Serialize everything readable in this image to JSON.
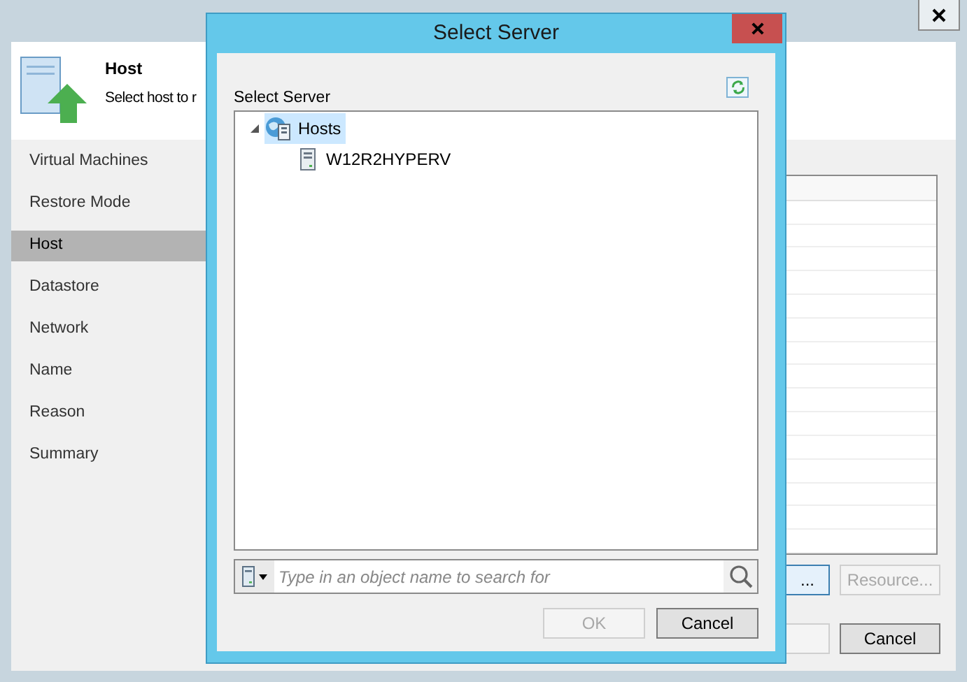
{
  "wizard": {
    "header": {
      "title": "Host",
      "description": "Select host to r"
    },
    "steps": [
      {
        "label": "Virtual Machines",
        "selected": false
      },
      {
        "label": "Restore Mode",
        "selected": false
      },
      {
        "label": "Host",
        "selected": true
      },
      {
        "label": "Datastore",
        "selected": false
      },
      {
        "label": "Network",
        "selected": false
      },
      {
        "label": "Name",
        "selected": false
      },
      {
        "label": "Reason",
        "selected": false
      },
      {
        "label": "Summary",
        "selected": false
      }
    ],
    "browse_button": {
      "label": "...",
      "disabled": false
    },
    "resource_button": {
      "label": "Resource...",
      "disabled": true
    },
    "cancel_button": {
      "label": "Cancel",
      "disabled": false
    }
  },
  "dialog": {
    "title": "Select Server",
    "label": "Select Server",
    "tree": [
      {
        "label": "Hosts",
        "selected": true,
        "expanded": true,
        "children": [
          {
            "label": "W12R2HYPERV",
            "selected": false
          }
        ]
      }
    ],
    "search": {
      "placeholder": "Type in an object name to search for"
    },
    "buttons": [
      {
        "label": "OK",
        "disabled": true
      },
      {
        "label": "Cancel",
        "disabled": false
      }
    ]
  }
}
